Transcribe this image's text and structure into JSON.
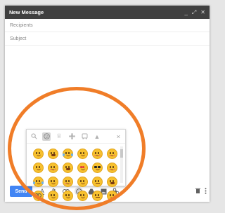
{
  "window": {
    "title": "New Message",
    "controls": [
      "_",
      "⤢",
      "✕"
    ]
  },
  "compose": {
    "recipients_placeholder": "Recipients",
    "subject_placeholder": "Subject",
    "send_label": "Send"
  },
  "emoji_picker": {
    "tabs": [
      {
        "name": "search-icon",
        "glyph": "🔍"
      },
      {
        "name": "smiley-tab-icon",
        "glyph": "☺"
      },
      {
        "name": "crown-tab-icon",
        "glyph": "♕"
      },
      {
        "name": "gear-tab-icon",
        "glyph": "✿"
      },
      {
        "name": "car-tab-icon",
        "glyph": "⌂"
      },
      {
        "name": "triangle-tab-icon",
        "glyph": "▲"
      }
    ],
    "close_glyph": "×",
    "emojis": [
      "grin",
      "grin-wide",
      "tears-of-joy",
      "smile",
      "blush",
      "smile-eyes",
      "grin",
      "blush",
      "grin-wide",
      "heart-eyes",
      "sunglasses",
      "blush",
      "sweat",
      "wink",
      "blush",
      "grin",
      "flat",
      "open",
      "glasses",
      "grin",
      "wink",
      "grin",
      "flat",
      "smile"
    ]
  },
  "toolbar": {
    "icons": [
      "format-icon",
      "attach-icon",
      "link-icon",
      "emoji-icon",
      "drive-icon",
      "photo-icon",
      "lock-icon"
    ],
    "right_icons": [
      "trash-icon",
      "more-icon"
    ]
  },
  "colors": {
    "titlebar": "#404040",
    "send_button": "#4285f4",
    "highlight": "#f07d28",
    "emoji_face": "#f7c12f"
  }
}
